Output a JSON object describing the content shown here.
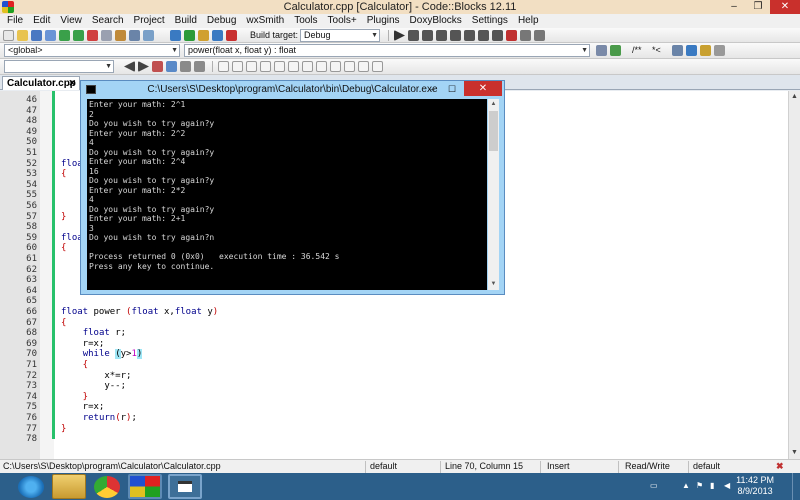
{
  "window": {
    "title": "Calculator.cpp [Calculator] - Code::Blocks 12.11"
  },
  "menu": [
    "File",
    "Edit",
    "View",
    "Search",
    "Project",
    "Build",
    "Debug",
    "wxSmith",
    "Tools",
    "Tools+",
    "Plugins",
    "DoxyBlocks",
    "Settings",
    "Help"
  ],
  "toolbar": {
    "build_target_label": "Build target:",
    "build_target_value": "Debug",
    "scope_value": "<global>",
    "function_value": "power(float x, float y) : float",
    "comment_label": "/**",
    "star_label": "*<"
  },
  "tab": {
    "label": "Calculator.cpp",
    "close": "✕"
  },
  "editor": {
    "lines": [
      {
        "n": "46",
        "code": [
          [
            "br",
            "    {"
          ]
        ]
      },
      {
        "n": "47",
        "code": []
      },
      {
        "n": "48",
        "code": []
      },
      {
        "n": "49",
        "code": []
      },
      {
        "n": "50",
        "code": [
          [
            "br",
            "    }"
          ]
        ]
      },
      {
        "n": "51",
        "code": []
      },
      {
        "n": "52",
        "code": [
          [
            "kw",
            "float"
          ]
        ]
      },
      {
        "n": "53",
        "code": [
          [
            "br",
            "{"
          ]
        ]
      },
      {
        "n": "54",
        "code": []
      },
      {
        "n": "55",
        "code": []
      },
      {
        "n": "56",
        "code": []
      },
      {
        "n": "57",
        "code": [
          [
            "br",
            "}"
          ]
        ]
      },
      {
        "n": "58",
        "code": []
      },
      {
        "n": "59",
        "code": [
          [
            "kw",
            "float"
          ]
        ]
      },
      {
        "n": "60",
        "code": [
          [
            "br",
            "{"
          ]
        ]
      },
      {
        "n": "61",
        "code": []
      },
      {
        "n": "62",
        "code": []
      },
      {
        "n": "63",
        "code": []
      },
      {
        "n": "64",
        "code": []
      },
      {
        "n": "65",
        "code": []
      },
      {
        "n": "66",
        "code": [
          [
            "kw",
            "float"
          ],
          [
            "t",
            " power "
          ],
          [
            "br",
            "("
          ],
          [
            "kw",
            "float"
          ],
          [
            "t",
            " x,"
          ],
          [
            "kw",
            "float"
          ],
          [
            "t",
            " y"
          ],
          [
            "br",
            ")"
          ]
        ]
      },
      {
        "n": "67",
        "code": [
          [
            "br",
            "{"
          ]
        ]
      },
      {
        "n": "68",
        "code": [
          [
            "t",
            "    "
          ],
          [
            "kw",
            "float"
          ],
          [
            "t",
            " r;"
          ]
        ]
      },
      {
        "n": "69",
        "code": [
          [
            "t",
            "    r=x;"
          ]
        ]
      },
      {
        "n": "70",
        "code": [
          [
            "t",
            "    "
          ],
          [
            "kw",
            "while"
          ],
          [
            "t",
            " "
          ],
          [
            "hl",
            "("
          ],
          [
            "t",
            "y>"
          ],
          [
            "num",
            "1"
          ],
          [
            "hl",
            ")"
          ]
        ]
      },
      {
        "n": "71",
        "code": [
          [
            "br",
            "    {"
          ]
        ]
      },
      {
        "n": "72",
        "code": [
          [
            "t",
            "        x*=r;"
          ]
        ]
      },
      {
        "n": "73",
        "code": [
          [
            "t",
            "        y--;"
          ]
        ]
      },
      {
        "n": "74",
        "code": [
          [
            "br",
            "    }"
          ]
        ]
      },
      {
        "n": "75",
        "code": [
          [
            "t",
            "    r=x;"
          ]
        ]
      },
      {
        "n": "76",
        "code": [
          [
            "t",
            "    "
          ],
          [
            "kw",
            "return"
          ],
          [
            "br",
            "("
          ],
          [
            "t",
            "r"
          ],
          [
            "br",
            ")"
          ],
          [
            "t",
            ";"
          ]
        ]
      },
      {
        "n": "77",
        "code": [
          [
            "br",
            "}"
          ]
        ]
      },
      {
        "n": "78",
        "code": []
      }
    ]
  },
  "console": {
    "title": "C:\\Users\\S\\Desktop\\program\\Calculator\\bin\\Debug\\Calculator.exe",
    "lines": [
      "Enter your math: 2^1",
      "2",
      "Do you wish to try again?y",
      "Enter your math: 2^2",
      "4",
      "Do you wish to try again?y",
      "Enter your math: 2^4",
      "16",
      "Do you wish to try again?y",
      "Enter your math: 2*2",
      "4",
      "Do you wish to try again?y",
      "Enter your math: 2+1",
      "3",
      "Do you wish to try again?n",
      "",
      "Process returned 0 (0x0)   execution time : 36.542 s",
      "Press any key to continue."
    ]
  },
  "status": {
    "path": "C:\\Users\\S\\Desktop\\program\\Calculator\\Calculator.cpp",
    "encoding": "default",
    "position": "Line 70, Column 15",
    "mode": "Insert",
    "access": "Read/Write",
    "profile": "default"
  },
  "taskbar": {
    "time": "11:42 PM",
    "date": "8/9/2013"
  }
}
